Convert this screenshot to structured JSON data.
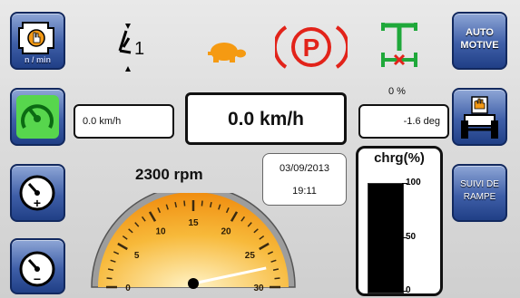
{
  "left_buttons": [
    {
      "icon": "engine-rpm-icon",
      "label": "n / min"
    },
    {
      "icon": "speed-gauge-icon",
      "label": ""
    },
    {
      "icon": "gauge-plus-icon",
      "label": ""
    },
    {
      "icon": "gauge-minus-icon",
      "label": ""
    }
  ],
  "right_buttons": {
    "auto_motive": "AUTO MOTIVE",
    "suivi": "SUIVI DE RAMPE",
    "tractor_icon": "tractor-hand-icon"
  },
  "indicators": {
    "gear": "1",
    "diff_lock_percent": "0 %"
  },
  "readouts": {
    "speed_small": "0.0 km/h",
    "speed_big": "0.0 km/h",
    "angle": "-1.6 deg",
    "rpm": "2300 rpm",
    "date": "03/09/2013",
    "time": "19:11"
  },
  "charge": {
    "title": "chrg(%)",
    "ticks": [
      "100",
      "50",
      "0"
    ],
    "level_percent": 100
  },
  "gauge": {
    "ticks": [
      "0",
      "5",
      "10",
      "15",
      "20",
      "25",
      "30"
    ],
    "needle_value": 28,
    "max": 30
  },
  "colors": {
    "button_blue": "#3f5fa8",
    "gauge_orange": "#f7a21b",
    "parking_red": "#e2231a",
    "turtle_orange": "#f59a12",
    "diff_green": "#1fa83a"
  }
}
